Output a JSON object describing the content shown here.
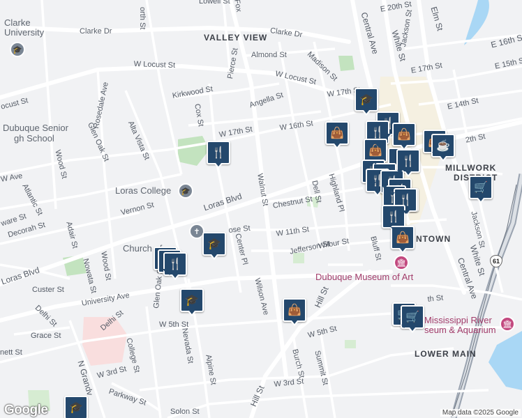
{
  "map": {
    "districts": {
      "valley_view": "VALLEY VIEW",
      "millwork": "MILLWORK",
      "millwork2": "DISTRICT",
      "downtown": "NTOWN",
      "lower_main": "LOWER MAIN"
    },
    "pois": {
      "clarke_university": "Clarke",
      "clarke_university2": "University",
      "dubuque_senior": "Dubuque Senior",
      "dubuque_senior2": "gh School",
      "loras_college": "Loras College",
      "church": "Church of",
      "museum_of_art": "Dubuque Museum of Art",
      "river_museum": "Mississippi River",
      "river_museum2": "seum & Aquarium"
    },
    "streets": {
      "lowell": "Lowell St",
      "clarke_dr_w": "Clarke Dr",
      "clarke_dr_e": "Clarke Dr",
      "almond": "Almond St",
      "w_locust_1": "W Locust St",
      "w_locust_2": "W Locust St",
      "locust_left": "ocust St",
      "kirkwood": "Kirkwood St",
      "cox": "Cox St",
      "pierce": "Pierce St",
      "angella": "Angella St",
      "madison": "Madison St",
      "w_17th_a": "W 17th St",
      "w_17th_b": "W 17th St",
      "w_16th": "W 16th St",
      "rosedale": "Rosedale Ave",
      "glen_oak_n": "Glen Oak St",
      "alta_vista": "Alta Vista St",
      "wood_n": "Wood St",
      "loras_blvd": "Loras Blvd",
      "loras_blvd_w": "Loras Blvd",
      "vernon": "Vernon St",
      "chestnut": "Chestnut St",
      "walnut": "Walnut St",
      "dell": "Dell St",
      "highland": "Highland Pl",
      "rose": "ose St",
      "w_11th": "W 11th St",
      "jefferson": "Jefferson St",
      "wilbur": "Wilbur St",
      "center_pl": "Center Pl",
      "bluff": "Bluff St",
      "atlantic": "Atlantic St",
      "delaware": "ware St",
      "decorah": "Decorah St",
      "adair": "Adair St",
      "nowata": "Nowata St",
      "wood_s": "Wood St",
      "custer": "Custer St",
      "university": "University Ave",
      "delhi_a": "Delhi St",
      "delhi_b": "Delhi St",
      "w_5th_a": "W 5th St",
      "w_5th_b": "W 5th St",
      "grace": "Grace St",
      "bennett": "nett St",
      "glen_oak_s": "Glen Oak St",
      "college": "College St",
      "nevada": "Nevada St",
      "alpine": "Alpine St",
      "n_grandview": "N Grandv",
      "w_3rd_a": "W 3rd St",
      "w_3rd_b": "W 3rd St",
      "parkway": "Parkway St",
      "solon": "Solon St",
      "hill_a": "Hill St",
      "hill_b": "Hill St",
      "wilson": "Wilson Ave",
      "burch": "Burch St",
      "summit": "Summit St",
      "central_n": "Central Ave",
      "central_s": "Central Ave",
      "white_n": "White St",
      "white_s": "White St",
      "jackson_n": "Jackson St",
      "jackson_s": "Jackson St",
      "elm": "Elm St",
      "e_20th": "E 20th St",
      "e_16th": "E 16th St",
      "e_15th": "E 15th St",
      "e_14th": "E 14th St",
      "e_17th": "E 17th St",
      "e_12th": "2th St",
      "w_17th_c": "W 17th St",
      "nw_abbr": "W Ave",
      "w_4th": "th St",
      "north": "orth St",
      "fox": "Fox"
    },
    "pins": {
      "school": "school-icon",
      "restaurant": "restaurant-icon",
      "shopping": "shopping-bag-icon",
      "cafe": "cafe-icon",
      "grocery": "shopping-cart-icon"
    },
    "route_badge": "61",
    "logo": "Google",
    "attribution": "Map data ©2025 Google",
    "colors": {
      "pin": "#24486c",
      "park": "#c7e7c4",
      "water": "#aadaff",
      "highway": "#9aa3b0"
    }
  }
}
